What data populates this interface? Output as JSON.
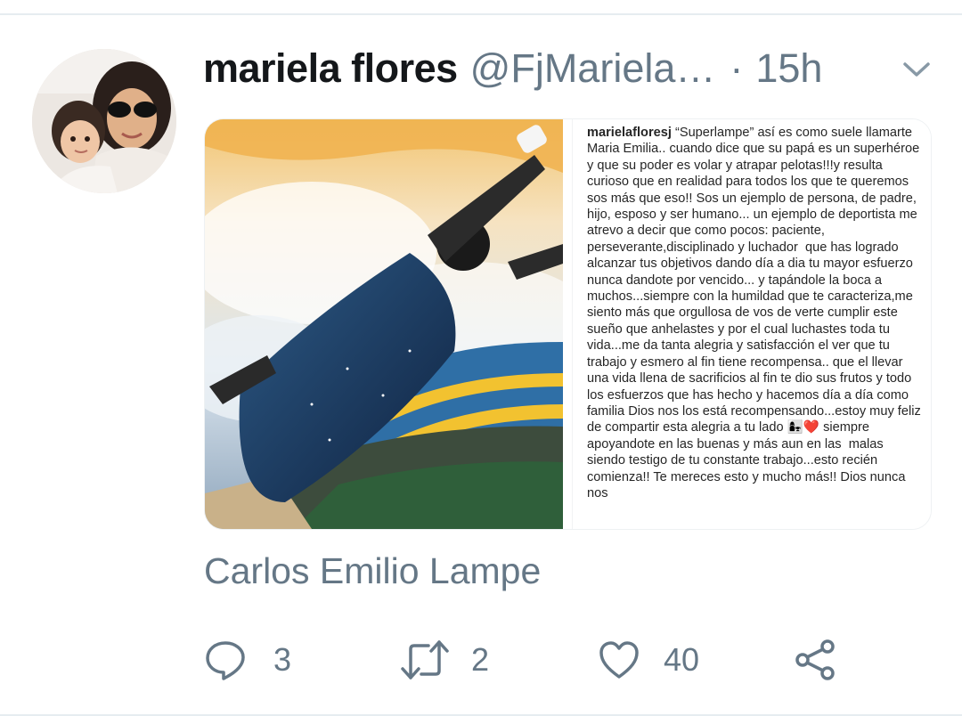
{
  "tweet": {
    "display_name": "mariela flores",
    "handle": "@FjMariela…",
    "separator": "·",
    "time": "15h",
    "text": "Carlos Emilio Lampe"
  },
  "caption": {
    "username": "marielafloresj",
    "body": " “Superlampe” así es como suele llamarte Maria Emilia.. cuando dice que su papá es un superhéroe y que su poder es volar y atrapar pelotas!!!y resulta curioso que en realidad para todos los que te queremos  sos más que eso!! Sos un ejemplo de persona, de padre, hijo, esposo y ser humano... un ejemplo de deportista me atrevo a decir que como pocos: paciente, perseverante,disciplinado y luchador  que has logrado alcanzar tus objetivos dando día a dia tu mayor esfuerzo nunca dandote por vencido... y tapándole la boca a muchos...siempre con la humildad que te caracteriza,me siento más que orgullosa de vos de verte cumplir este sueño que anhelastes y por el cual luchastes toda tu vida...me da tanta alegria y satisfacción el ver que tu trabajo y esmero al fin tiene recompensa.. que el llevar una vida llena de sacrificios al fin te dio sus frutos y todo los esfuerzos que has hecho y hacemos día a día como familia Dios nos los está recompensando...estoy muy feliz de compartir esta alegria a tu lado 👩‍👧❤️ siempre apoyandote en las buenas y más aun en las  malas siendo testigo de tu constante trabajo...esto recién comienza!! Te mereces esto y mucho más!! Dios nunca nos"
  },
  "actions": {
    "replies": "3",
    "retweets": "2",
    "likes": "40"
  },
  "icons": {
    "reply": "speech-bubble-icon",
    "retweet": "retweet-arrows-icon",
    "like": "heart-icon",
    "share": "share-nodes-icon",
    "menu": "chevron-down-icon"
  },
  "colors": {
    "text_primary": "#14171a",
    "text_secondary": "#657786",
    "divider": "#e6ecf0"
  }
}
